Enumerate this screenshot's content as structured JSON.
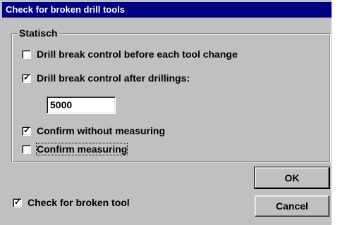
{
  "window": {
    "title": "Check for broken drill tools"
  },
  "group": {
    "legend": "Statisch",
    "options": [
      {
        "label": "Drill break control before each tool change",
        "checked": false
      },
      {
        "label": "Drill break control after drillings:",
        "checked": true
      },
      {
        "label": "Confirm without measuring",
        "checked": true
      },
      {
        "label": "Confirm measuring",
        "checked": false
      }
    ],
    "drillings_value": "5000"
  },
  "bottom": {
    "check_broken_label": "Check for broken tool",
    "check_broken_checked": true
  },
  "buttons": {
    "ok_label": "OK",
    "cancel_label": "Cancel"
  },
  "marks": {
    "checked_glyph": "✓"
  },
  "colors": {
    "titlebar": "#000080",
    "face": "#c0c0c0"
  }
}
